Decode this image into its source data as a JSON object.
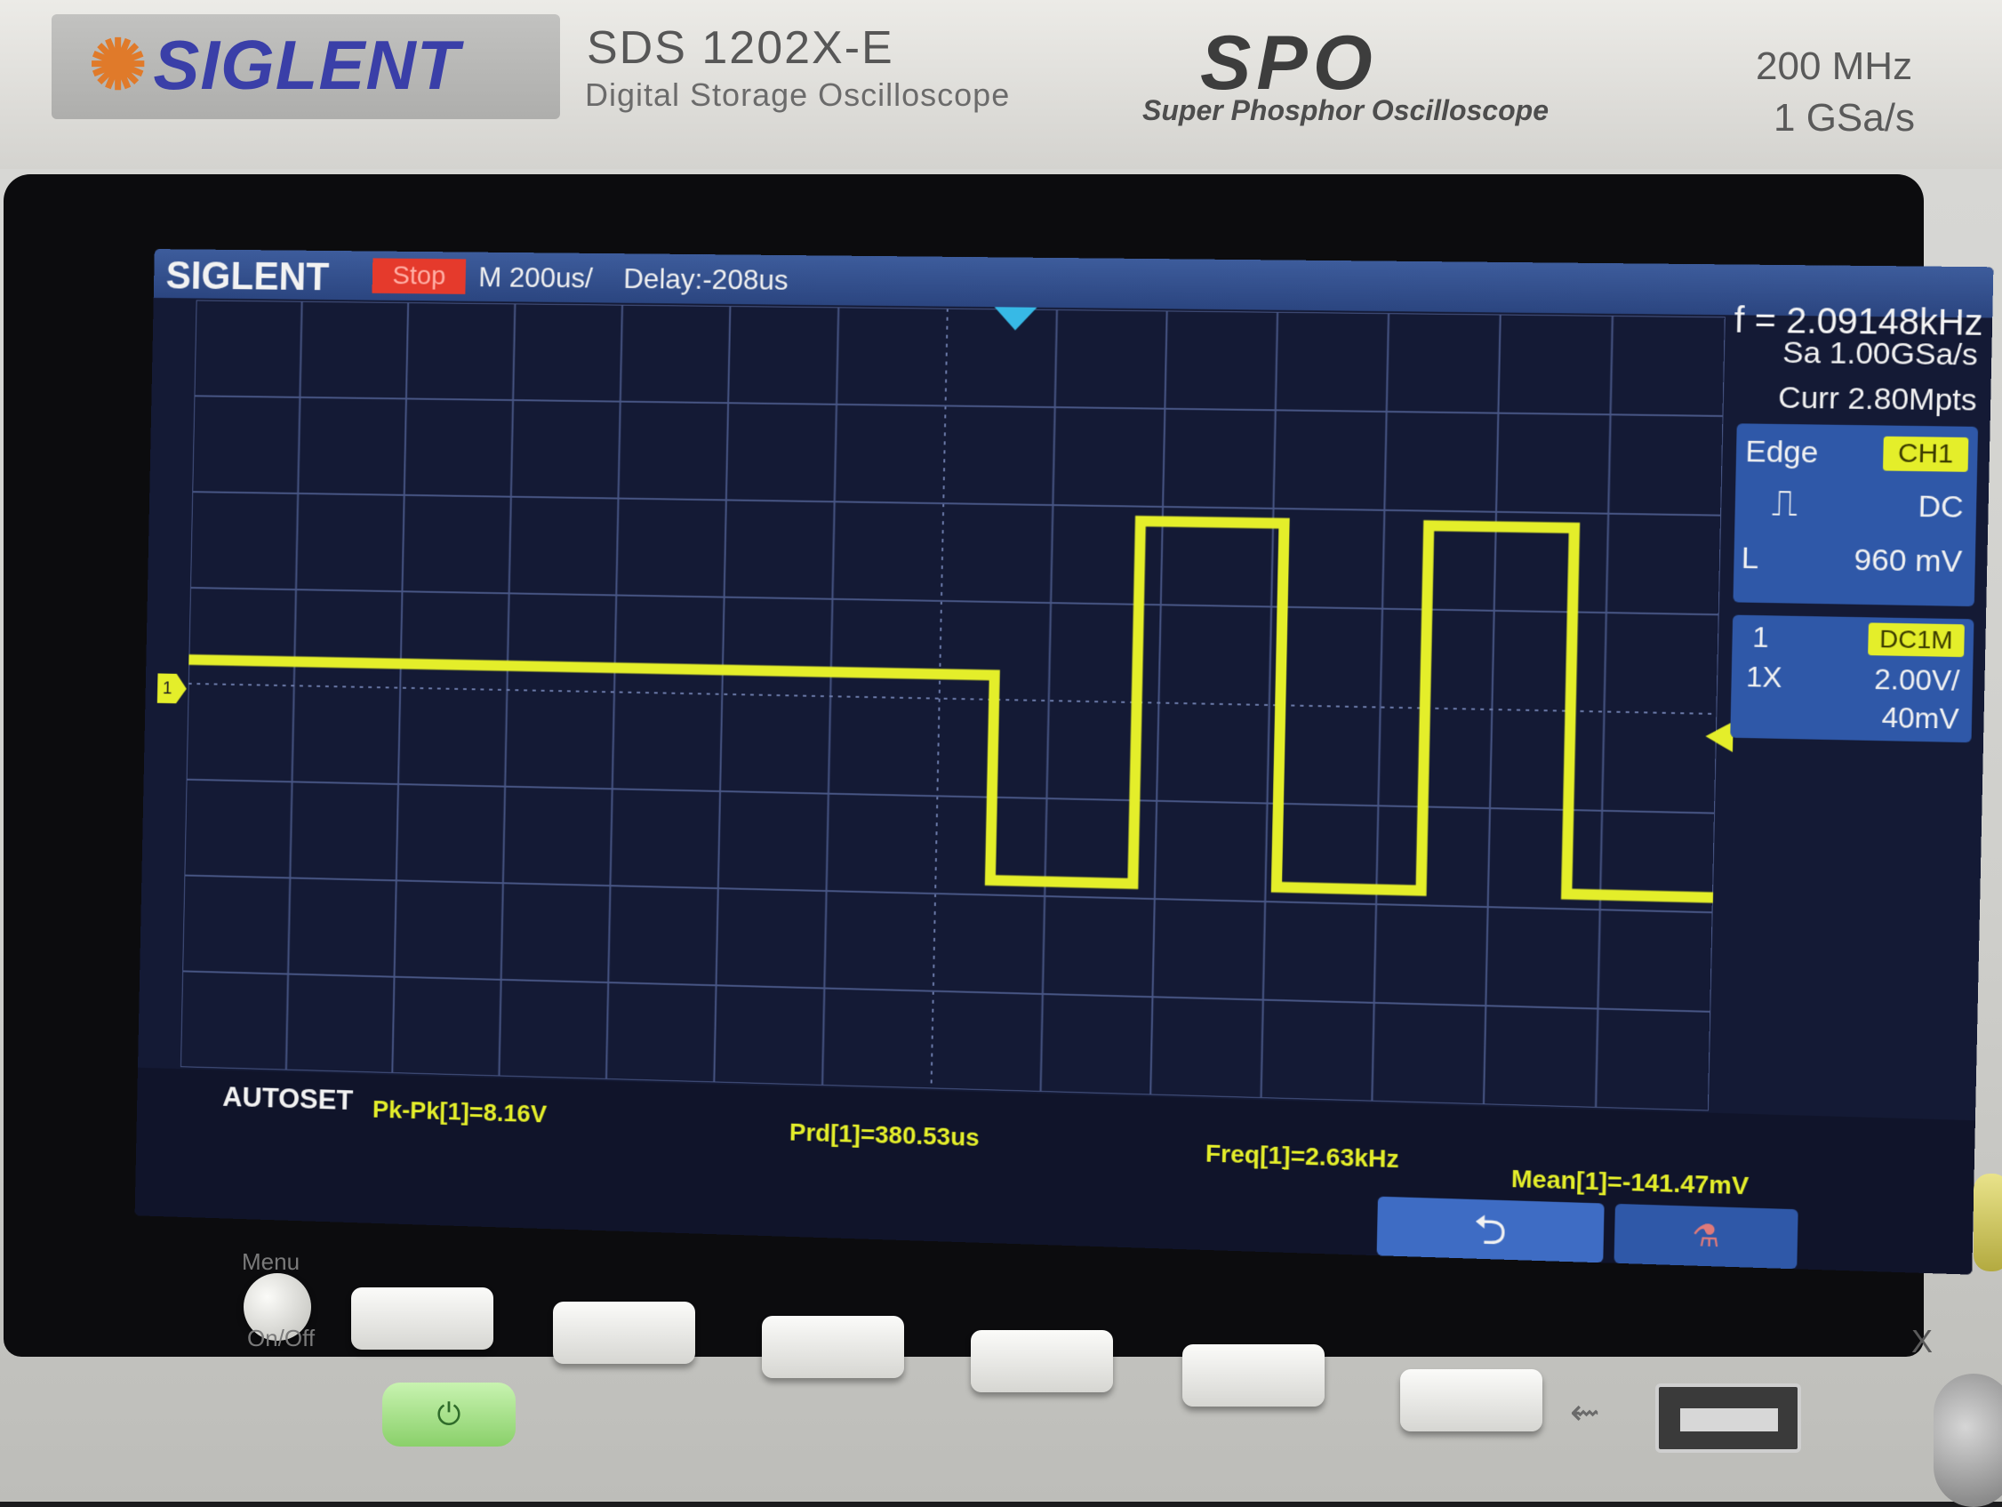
{
  "instrument": {
    "brand": "SIGLENT",
    "model": "SDS 1202X-E",
    "description": "Digital Storage Oscilloscope",
    "series_logo": "SPO",
    "series_description": "Super Phosphor Oscilloscope",
    "bandwidth": "200 MHz",
    "sample_rate": "1 GSa/s"
  },
  "screen": {
    "logo": "SIGLENT",
    "run_state": "Stop",
    "timebase": "M 200us/",
    "delay": "Delay:-208us",
    "frequency": "f = 2.09148kHz",
    "sample_rate": "Sa 1.00GSa/s",
    "memory_depth": "Curr 2.80Mpts",
    "trigger": {
      "type": "Edge",
      "source": "CH1",
      "slope_icon": "rising-edge-icon",
      "coupling": "DC",
      "level_label": "L",
      "level": "960 mV"
    },
    "channel": {
      "number": "1",
      "coupling": "DC1M",
      "probe": "1X",
      "scale": "2.00V/",
      "offset": "40mV"
    },
    "ch1_marker": "1",
    "autoset_label": "AUTOSET",
    "measurements": {
      "pk_pk": "Pk-Pk[1]=8.16V",
      "period": "Prd[1]=380.53us",
      "frequency": "Freq[1]=2.63kHz",
      "mean": "Mean[1]=-141.47mV"
    },
    "back_icon": "return-arrow-icon",
    "network_icon": "network-icon"
  },
  "front_panel": {
    "menu_label": "Menu",
    "onoff_label": "On/Off",
    "power_icon": "power-icon",
    "usb_icon": "usb-icon",
    "x_label": "X"
  },
  "colors": {
    "trace": "#e4ee2a",
    "screen_bg": "#141a35",
    "status_bar": "#2b4580",
    "run_state": "#e53a2c",
    "trigger_marker": "#37b9e6"
  },
  "waveform": {
    "channel": "CH1",
    "time_per_div_us": 200,
    "volts_per_div": 2,
    "divisions": [
      14,
      8
    ],
    "segments": [
      {
        "t_div": [
          0,
          7.5
        ],
        "v_div": 0.25
      },
      {
        "t_div": [
          7.5,
          8.8
        ],
        "v_div": -1.85
      },
      {
        "t_div": [
          8.8,
          10.1
        ],
        "v_div": 1.85
      },
      {
        "t_div": [
          10.1,
          11.4
        ],
        "v_div": -1.85
      },
      {
        "t_div": [
          11.4,
          12.7
        ],
        "v_div": 1.85
      },
      {
        "t_div": [
          12.7,
          14
        ],
        "v_div": -1.85
      }
    ]
  }
}
